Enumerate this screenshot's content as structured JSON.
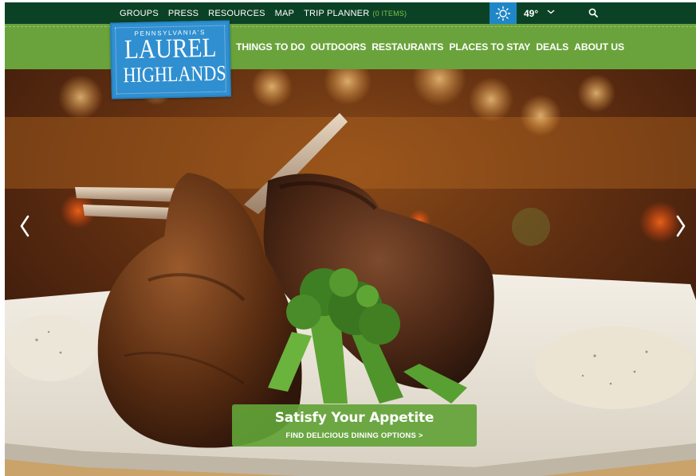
{
  "topbar": {
    "links": [
      "GROUPS",
      "PRESS",
      "RESOURCES",
      "MAP",
      "TRIP PLANNER"
    ],
    "trip_count": "(0 ITEMS)",
    "weather": {
      "temperature": "49°",
      "icon": "sun-icon"
    },
    "search_icon": "search-icon",
    "colors": {
      "bar": "#0b4226",
      "weather_box": "#1f86c8",
      "trip_count": "#7fc24a"
    }
  },
  "logo": {
    "top": "PENNSYLVANIA'S",
    "line1": "LAUREL",
    "line2": "HIGHLANDS",
    "color": "#2f8fd0"
  },
  "nav": {
    "items": [
      "THINGS TO DO",
      "OUTDOORS",
      "RESTAURANTS",
      "PLACES TO STAY",
      "DEALS",
      "ABOUT US"
    ],
    "color": "#6aa33b"
  },
  "hero": {
    "prev_icon": "chevron-left-icon",
    "next_icon": "chevron-right-icon",
    "cta": {
      "title": "Satisfy Your Appetite",
      "subtitle": "FIND DELICIOUS DINING OPTIONS >"
    }
  }
}
